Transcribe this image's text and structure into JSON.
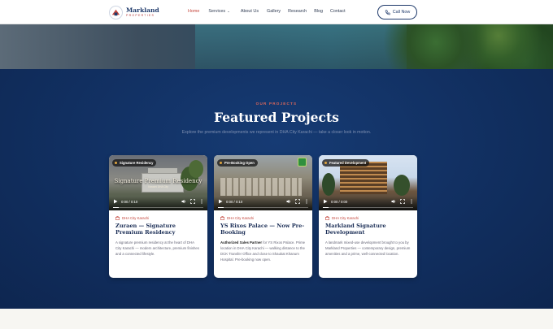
{
  "nav": {
    "logo_name": "Markland",
    "logo_sub": "PROPERTIES",
    "items": [
      {
        "label": "Home",
        "active": true
      },
      {
        "label": "Services",
        "dropdown": true
      },
      {
        "label": "About Us"
      },
      {
        "label": "Gallery"
      },
      {
        "label": "Research"
      },
      {
        "label": "Blog"
      },
      {
        "label": "Contact"
      }
    ],
    "call_label": "Call Now"
  },
  "section": {
    "eyebrow": "OUR PROJECTS",
    "title": "Featured Projects",
    "subtitle": "Explore the premium developments we represent in DHA City Karachi — take a closer look in motion."
  },
  "cards": [
    {
      "badge": "Signature Residency",
      "overlay_title": "Signature Premium Residency",
      "overlay_sub": "Karachi DHA City",
      "time": "0:00 / 0:10",
      "location": "DHA City Karachi",
      "title": "Zuraen — Signature Premium Residency",
      "desc_bold": "",
      "desc": "A signature premium residency at the heart of DHA City Karachi — modern architecture, premium finishes and a connected lifestyle."
    },
    {
      "badge": "Pre-Booking Open",
      "time": "0:00 / 0:10",
      "location": "DHA City Karachi",
      "title": "YS Rixos Palace — Now Pre-Booking",
      "desc_bold": "Authorized Sales Partner",
      "desc": " for YS Rixos Palace. Prime location in DHA City Karachi — walking distance to the DCK Transfer Office and close to Shaukat Khanum Hospital. Pre-booking now open."
    },
    {
      "badge": "Featured Development",
      "time": "0:00 / 0:00",
      "location": "DHA City Karachi",
      "title": "Markland Signature Development",
      "desc_bold": "",
      "desc": "A landmark mixed-use development brought to you by Markland Properties — contemporary design, premium amenities and a prime, well-connected location."
    }
  ]
}
